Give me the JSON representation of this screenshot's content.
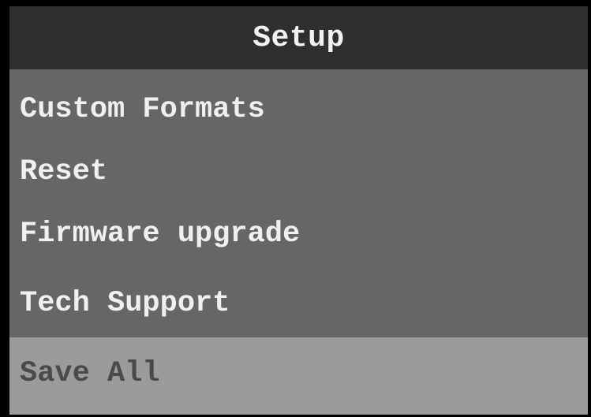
{
  "title": "Setup",
  "menu": {
    "items": [
      {
        "label": "Custom Formats"
      },
      {
        "label": "Reset"
      },
      {
        "label": "Firmware upgrade"
      },
      {
        "label": "Tech Support"
      },
      {
        "label": "Save All",
        "selected": true
      }
    ]
  },
  "colors": {
    "title_bar": "#2f2f2f",
    "menu_background": "#666666",
    "selected_background": "#9b9b9b",
    "text": "#f0f0f0",
    "selected_text": "#4a4a4a"
  }
}
